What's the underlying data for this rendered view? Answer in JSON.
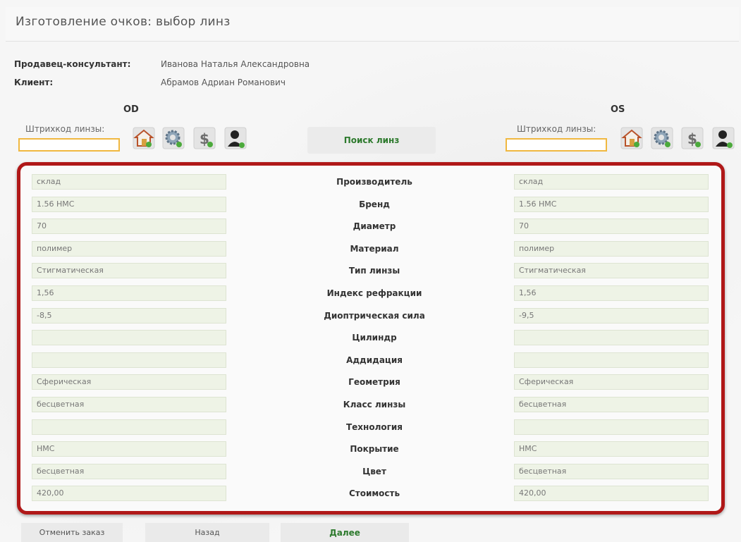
{
  "page": {
    "title": "Изготовление очков: выбор линз"
  },
  "info": {
    "seller_label": "Продавец-консультант:",
    "seller_value": "Иванова Наталья Александровна",
    "client_label": "Клиент:",
    "client_value": "Абрамов Адриан Романович"
  },
  "eyes": {
    "od_label": "OD",
    "os_label": "OS",
    "barcode_label": "Штрихкод линзы:"
  },
  "toolbar": {
    "icons": [
      "warehouse-icon",
      "settings-gear-icon",
      "price-dollar-icon",
      "user-icon"
    ],
    "search_label": "Поиск линз"
  },
  "fields": [
    {
      "label": "Производитель",
      "od": "склад",
      "os": "склад"
    },
    {
      "label": "Бренд",
      "od": "1.56 HMC",
      "os": "1.56 HMC"
    },
    {
      "label": "Диаметр",
      "od": "70",
      "os": "70"
    },
    {
      "label": "Материал",
      "od": "полимер",
      "os": "полимер"
    },
    {
      "label": "Тип линзы",
      "od": "Стигматическая",
      "os": "Стигматическая"
    },
    {
      "label": "Индекс рефракции",
      "od": "1,56",
      "os": "1,56"
    },
    {
      "label": "Диоптрическая сила",
      "od": "-8,5",
      "os": "-9,5"
    },
    {
      "label": "Цилиндр",
      "od": "",
      "os": ""
    },
    {
      "label": "Аддидация",
      "od": "",
      "os": ""
    },
    {
      "label": "Геометрия",
      "od": "Сферическая",
      "os": "Сферическая"
    },
    {
      "label": "Класс линзы",
      "od": "бесцветная",
      "os": "бесцветная"
    },
    {
      "label": "Технология",
      "od": "",
      "os": ""
    },
    {
      "label": "Покрытие",
      "od": "HMC",
      "os": "HMC"
    },
    {
      "label": "Цвет",
      "od": "бесцветная",
      "os": "бесцветная"
    },
    {
      "label": "Стоимость",
      "od": "420,00",
      "os": "420,00"
    }
  ],
  "footer": {
    "cancel_label": "Отменить заказ",
    "back_label": "Назад",
    "next_label": "Далее"
  },
  "colors": {
    "frame": "#b01818",
    "accent_green": "#2d7a2d",
    "field_bg": "#eef3e6",
    "barcode_border": "#f0b840"
  }
}
